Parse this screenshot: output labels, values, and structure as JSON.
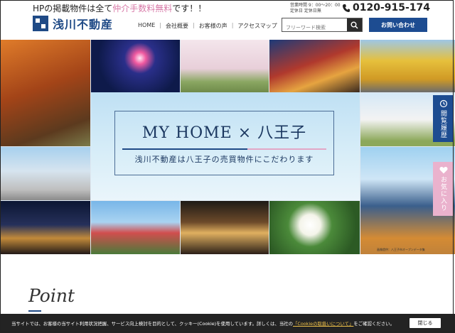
{
  "header": {
    "tagline_prefix": "HPの掲載物件は全て",
    "tagline_highlight": "仲介手数料無料",
    "tagline_suffix": "です！！",
    "logo_text": "浅川不動産",
    "hours_line1": "営業時間 9：00～20：00",
    "hours_line2": "定休日 定休日無",
    "phone": "0120-915-174",
    "search_placeholder": "フリーワード検索",
    "contact_label": "お問い合わせ",
    "nav": [
      {
        "label": "HOME"
      },
      {
        "label": "会社概要"
      },
      {
        "label": "お客様の声"
      },
      {
        "label": "アクセスマップ"
      }
    ]
  },
  "hero": {
    "title": "MY HOME × 八王子",
    "subtitle": "浅川不動産は八王子の売買物件にこだわります",
    "photo_credit": "画像提供：八王子市オープンデータ集"
  },
  "side": {
    "history_label": "閲覧履歴",
    "favorite_label": "お気に入り"
  },
  "section": {
    "point_title": "Point"
  },
  "cookie": {
    "text_before": "当サイトでは、お客様の当サイト利用状況把握、サービス向上検討を目的として、クッキー(Cookie)を使用しています。詳しくは、当社の",
    "link": "「Cookieの取扱いについて」",
    "text_after": "をご確認ください。",
    "close_label": "閉じる"
  },
  "colors": {
    "brand_blue": "#1d4c91",
    "accent_pink": "#e2a7c6",
    "tagline_pink": "#d87aa8"
  }
}
